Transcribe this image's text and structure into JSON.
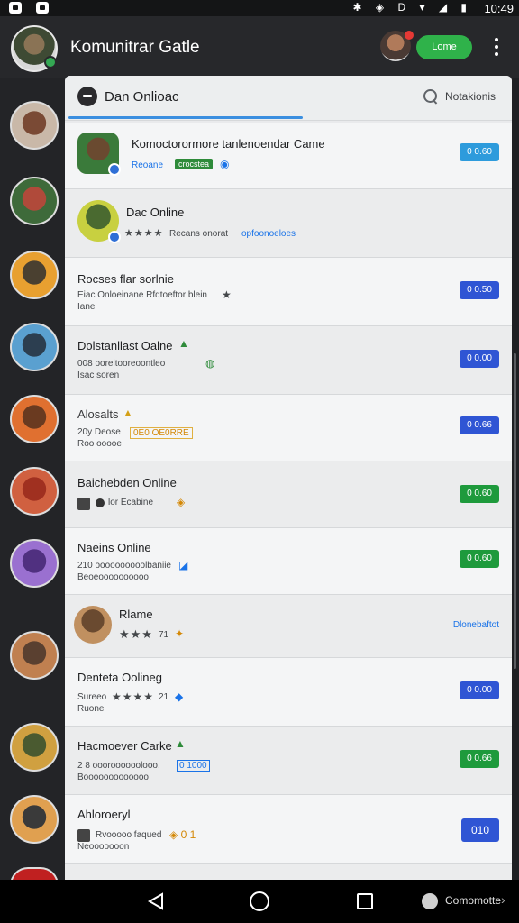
{
  "status_bar": {
    "time": "10:49",
    "icons": "✱ ◈ D ▾ ◢ ▮"
  },
  "header": {
    "title": "Komunitrar Gatle",
    "home_button": "Lome"
  },
  "tabs": {
    "active_label": "Dan Onlioac",
    "right_label": "Notakionis"
  },
  "rows": [
    {
      "title": "Komoctorormore tanlenoendar Came",
      "sub": "Reoane",
      "tag": "crocstea",
      "badge_icon": "shield-icon",
      "button": "0 0.60"
    },
    {
      "title": "Dac Online",
      "stars": "★★★★",
      "sub": "Recans onorat",
      "link": "opfoonoeloes"
    },
    {
      "title": "Rocses flar sorlnie",
      "sub": "Eiac Onloeinane Rfqtoeftor blein",
      "extra": "★",
      "sub2": "Iane",
      "button": "0 0.50"
    },
    {
      "title": "Dolstanllast Oalne",
      "title_icon": "▲",
      "sub": "008 ooreltooreoontleo",
      "extra": "◍",
      "sub2": "Isac soren",
      "button": "0 0.00"
    },
    {
      "title": "Alosalts",
      "title_icon": "▲",
      "sub": "20y Deose",
      "sub_tag": "0E0 OE0RRE",
      "sub2": "Roo ooooe",
      "button": "0 0.66"
    },
    {
      "title": "Baichebden Online",
      "sub": "lor Ecabine",
      "extra": "◈",
      "button": "0 0.60"
    },
    {
      "title": "Naeins Online",
      "sub": "210 oooooooooolbaniie",
      "extra": "◪",
      "sub2": "Beoeoooooooooo",
      "button": "0 0.60"
    },
    {
      "title": "Rlame",
      "stars": "★★★",
      "stars_num": "71",
      "extra": "✦",
      "link": "Dlonebaftot"
    },
    {
      "title": "Denteta Oolineg",
      "sub": "Sureeo",
      "stars": "★★★★",
      "stars_num": "21",
      "extra": "◆",
      "sub2": "Ruone",
      "button": "0 0.00"
    },
    {
      "title": "Hacmoever Carke",
      "title_icon": "▲",
      "sub": "2 8 oooroooooolooo.",
      "sub_tag": "0 1000",
      "sub2": "Booooooooooooo",
      "button": "0 0.66"
    },
    {
      "title": "Ahloroeryl",
      "sub": "Rvooooo faqued",
      "extra": "◈ 0 1",
      "sub2": "Neooooooon",
      "button": "010"
    }
  ],
  "navbar": {
    "extra_label": "Comomotte",
    "chevron": "›"
  },
  "colors": {
    "accent": "#2fb24a",
    "tab_underline": "#3b8fe0",
    "pill_blue": "#2f55d4",
    "pill_green": "#1e9a3c",
    "pill_lightblue": "#2d9bdc"
  }
}
